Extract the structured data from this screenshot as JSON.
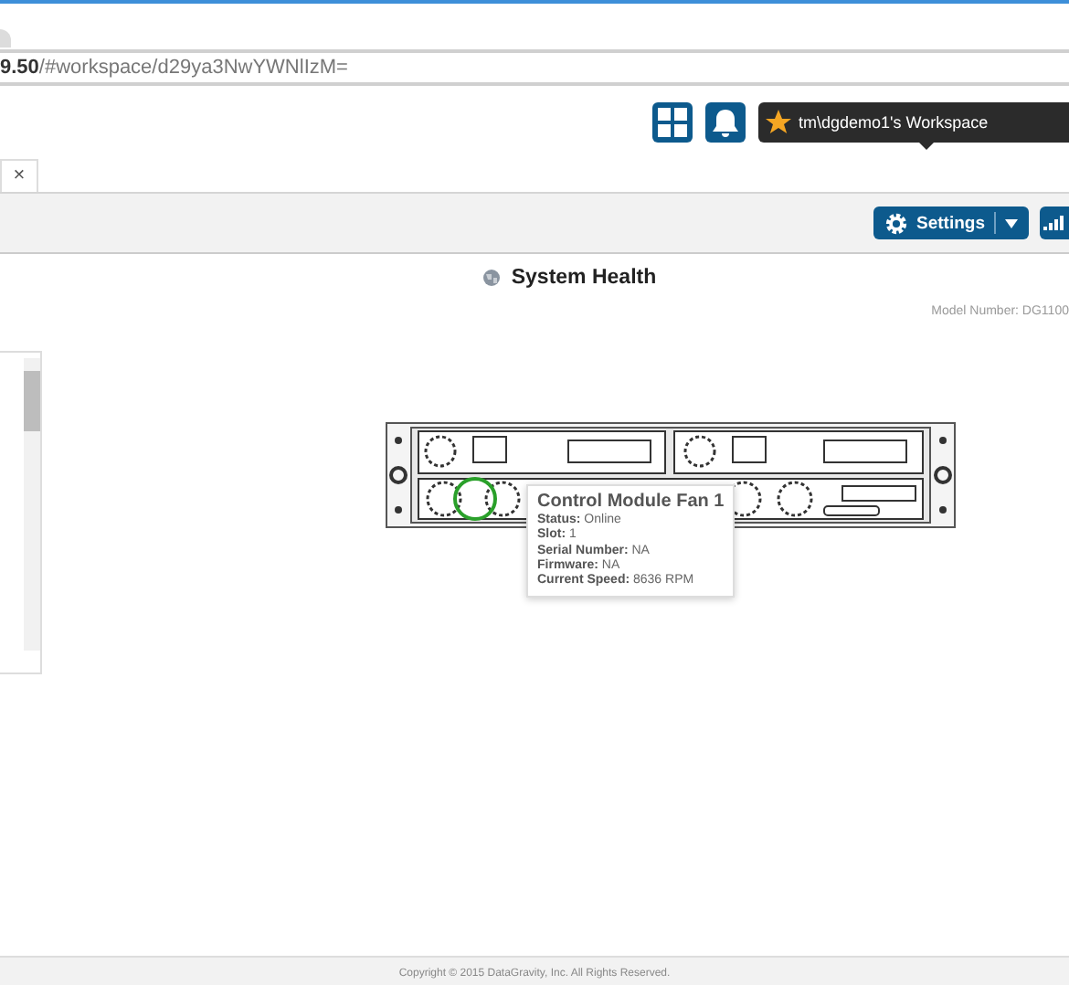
{
  "address_bar": {
    "url": "**9.50**/#workspace/d29ya3NwYWNlIzM="
  },
  "header": {
    "workspace": "tm\\dgdemo1's Workspace"
  },
  "tabs": [
    {
      "close": "×",
      "selected": true
    }
  ],
  "toolbar": {
    "settings_button": "Settings"
  },
  "panel": {
    "title": "System Health",
    "model_number": "Model Number: DG1100"
  },
  "tooltip": {
    "title": "Control Module Fan 1",
    "fields": [
      {
        "label": "Status:",
        "value": "Online"
      },
      {
        "label": "Slot:",
        "value": "1"
      },
      {
        "label": "Serial Number:",
        "value": "NA"
      },
      {
        "label": "Firmware:",
        "value": "NA"
      },
      {
        "label": "Current Speed:",
        "value": "8636 RPM"
      }
    ]
  },
  "footer": "Copyright © 2015 DataGravity, Inc. All Rights Reserved."
}
